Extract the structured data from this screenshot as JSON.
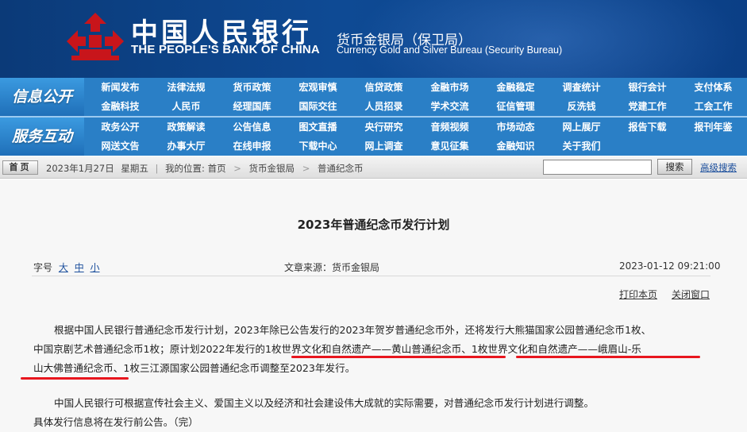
{
  "header": {
    "cn_name": "中国人民银行",
    "en_name": "THE PEOPLE'S BANK OF CHINA",
    "bureau_cn": "货币金银局（保卫局）",
    "bureau_en": "Currency  Gold and Silver Bureau (Security Bureau)",
    "logo_color": "#c8151b"
  },
  "nav": {
    "block1_label": "信息公开",
    "block2_label": "服务互动",
    "rows": [
      [
        "新闻发布",
        "法律法规",
        "货币政策",
        "宏观审慎",
        "信贷政策",
        "金融市场",
        "金融稳定",
        "调查统计",
        "银行会计",
        "支付体系"
      ],
      [
        "金融科技",
        "人民币",
        "经理国库",
        "国际交往",
        "人员招录",
        "学术交流",
        "征信管理",
        "反洗钱",
        "党建工作",
        "工会工作"
      ],
      [
        "政务公开",
        "政策解读",
        "公告信息",
        "图文直播",
        "央行研究",
        "音频视频",
        "市场动态",
        "网上展厅",
        "报告下载",
        "报刊年鉴"
      ],
      [
        "网送文告",
        "办事大厅",
        "在线申报",
        "下载中心",
        "网上调查",
        "意见征集",
        "金融知识",
        "关于我们"
      ]
    ]
  },
  "locbar": {
    "home_label": "首页",
    "date": "2023年1月27日",
    "weekday": "星期五",
    "location_prefix": "我的位置:",
    "crumbs": [
      "首页",
      "货币金银局",
      "普通纪念币"
    ],
    "search_placeholder": "",
    "search_button": "搜索",
    "advanced_search": "高级搜索"
  },
  "article": {
    "title": "2023年普通纪念币发行计划",
    "font_size_label": "字号",
    "font_sizes": [
      "大",
      "中",
      "小"
    ],
    "source": "文章来源：货币金银局",
    "datetime": "2023-01-12  09:21:00",
    "print_label": "打印本页",
    "close_label": "关闭窗口",
    "para1_line1": "根据中国人民银行普通纪念币发行计划，2023年除已公告发行的2023年贺岁普通纪念币外，还将发行大熊猫国家公园普通纪念币1枚、",
    "para1_line2": "中国京剧艺术普通纪念币1枚；原计划2022年发行的1枚世界文化和自然遗产——黄山普通纪念币、1枚世界文化和自然遗产——峨眉山-乐",
    "para1_line3": "山大佛普通纪念币、1枚三江源国家公园普通纪念币调整至2023年发行。",
    "para2_line1": "中国人民银行可根据宣传社会主义、爱国主义以及经济和社会建设伟大成就的实际需要，对普通纪念币发行计划进行调整。",
    "para2_line2": "具体发行信息将在发行前公告。（完）",
    "highlight_color": "#e8161e"
  }
}
